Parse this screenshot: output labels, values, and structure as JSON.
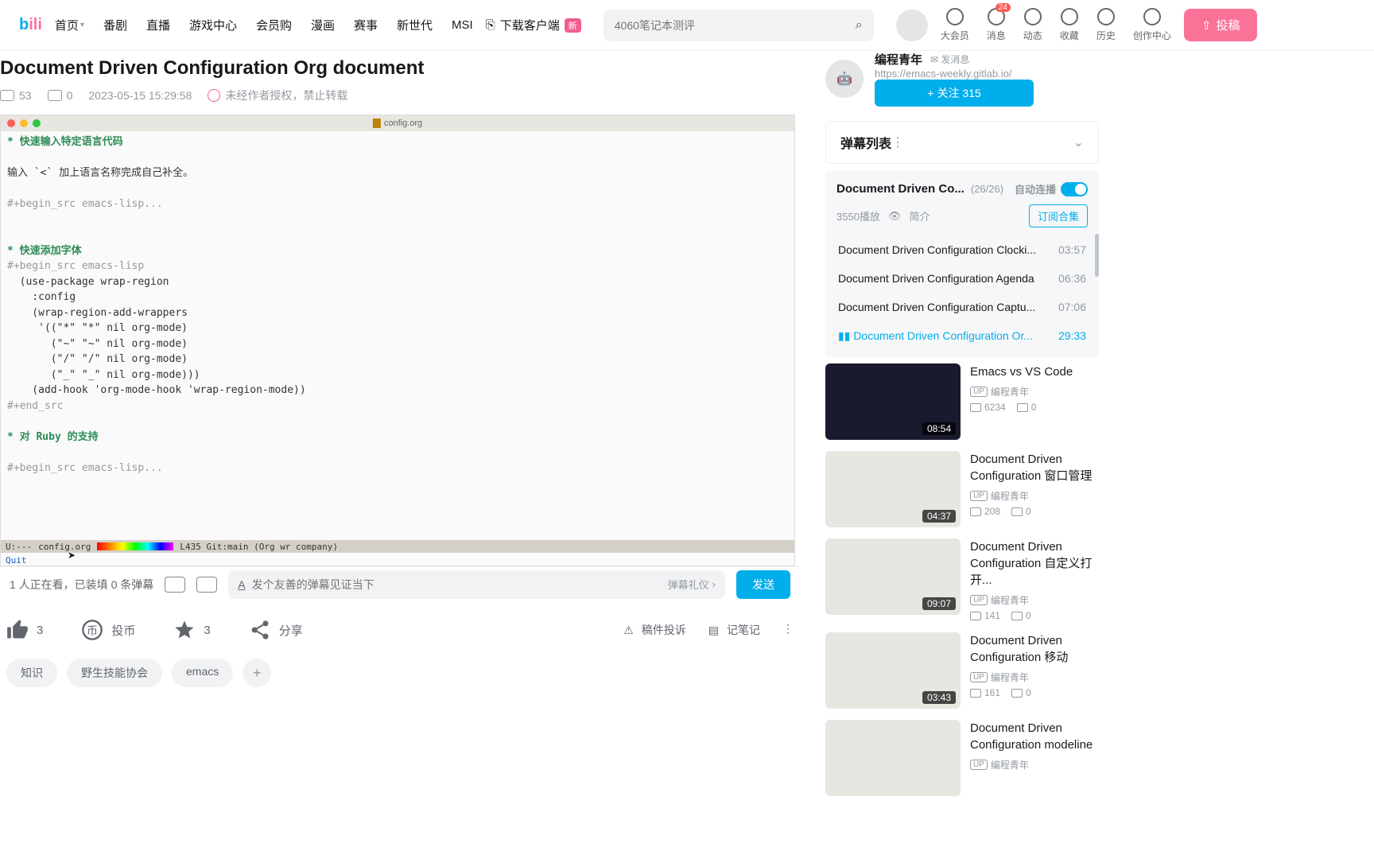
{
  "header": {
    "logo": "bili",
    "nav": [
      "首页",
      "番剧",
      "直播",
      "游戏中心",
      "会员购",
      "漫画",
      "赛事",
      "新世代",
      "MSI"
    ],
    "download": "下载客户端",
    "search_placeholder": "4060笔记本测评",
    "icons": [
      {
        "label": "大会员"
      },
      {
        "label": "消息",
        "badge": "24"
      },
      {
        "label": "动态"
      },
      {
        "label": "收藏"
      },
      {
        "label": "历史"
      },
      {
        "label": "创作中心"
      }
    ],
    "submit": "投稿"
  },
  "video": {
    "title": "Document Driven Configuration Org document",
    "plays": "53",
    "danmu": "0",
    "date": "2023-05-15 15:29:58",
    "forbid": "未经作者授权，禁止转载"
  },
  "editor": {
    "file": "config.org",
    "h1": "* 快速输入特定语言代码",
    "p1": "输入 `<` 加上语言名称完成自己补全。",
    "src1": "#+begin_src emacs-lisp...",
    "h2": "* 快速添加字体",
    "src2a": "#+begin_src emacs-lisp",
    "code": "  (use-package wrap-region\n    :config\n    (wrap-region-add-wrappers\n     '((\"*\" \"*\" nil org-mode)\n       (\"~\" \"~\" nil org-mode)\n       (\"/\" \"/\" nil org-mode)\n       (\"_\" \"_\" nil org-mode)))\n    (add-hook 'org-mode-hook 'wrap-region-mode))",
    "src2b": "#+end_src",
    "h3": "* 对 Ruby 的支持",
    "src3": "#+begin_src emacs-lisp...",
    "status_l": "U:---",
    "status_file": "config.org",
    "status_r": "L435  Git:main  (Org wr company)",
    "minibuf": "Quit"
  },
  "controls": {
    "watching": "1 人正在看，已装填 0 条弹幕",
    "input_placeholder": "发个友善的弹幕见证当下",
    "etiquette": "弹幕礼仪",
    "send": "发送"
  },
  "actions": {
    "like": "3",
    "coin": "投币",
    "fav": "3",
    "share": "分享",
    "report": "稿件投诉",
    "note": "记笔记"
  },
  "tags": [
    "知识",
    "野生技能协会",
    "emacs"
  ],
  "author": {
    "name": "编程青年",
    "link": "https://emacs-weekly.gitlab.io/",
    "follow": "关注 315",
    "msg": "发消息"
  },
  "danmu_panel": {
    "title": "弹幕列表"
  },
  "playlist": {
    "title": "Document Driven Co...",
    "count": "(26/26)",
    "auto": "自动连播",
    "plays": "3550播放",
    "intro": "简介",
    "subscribe": "订阅合集",
    "items": [
      {
        "title": "Document Driven Configuration Clocki...",
        "time": "03:57",
        "active": false
      },
      {
        "title": "Document Driven Configuration Agenda",
        "time": "06:36",
        "active": false
      },
      {
        "title": "Document Driven Configuration Captu...",
        "time": "07:06",
        "active": false
      },
      {
        "title": "Document Driven Configuration Or...",
        "time": "29:33",
        "active": true
      }
    ]
  },
  "reco": [
    {
      "title": "Emacs vs VS Code",
      "up": "编程青年",
      "views": "6234",
      "dm": "0",
      "dur": "08:54",
      "dark": true
    },
    {
      "title": "Document Driven Configuration 窗口管理",
      "up": "编程青年",
      "views": "208",
      "dm": "0",
      "dur": "04:37",
      "dark": false
    },
    {
      "title": "Document Driven Configuration 自定义打开...",
      "up": "编程青年",
      "views": "141",
      "dm": "0",
      "dur": "09:07",
      "dark": false
    },
    {
      "title": "Document Driven Configuration 移动",
      "up": "编程青年",
      "views": "161",
      "dm": "0",
      "dur": "03:43",
      "dark": false
    },
    {
      "title": "Document Driven Configuration modeline",
      "up": "编程青年",
      "views": "",
      "dm": "",
      "dur": "",
      "dark": false
    }
  ]
}
